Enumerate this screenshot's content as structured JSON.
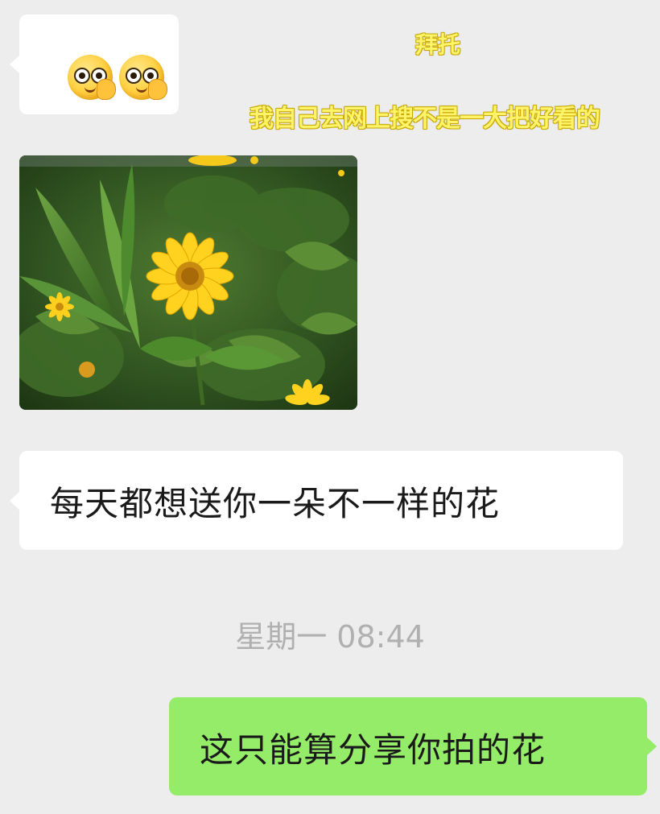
{
  "captions": {
    "line1": "拜托",
    "line2": "我自己去网上搜不是一大把好看的"
  },
  "messages": [
    {
      "sender": "other",
      "type": "sticker",
      "content": [
        "thinking-face-emoji",
        "thinking-face-emoji"
      ]
    },
    {
      "sender": "other",
      "type": "photo",
      "content": "yellow-flower-photo"
    },
    {
      "sender": "other",
      "type": "text",
      "text": "每天都想送你一朵不一样的花"
    },
    {
      "type": "timestamp",
      "text": "星期一 08:44"
    },
    {
      "sender": "me",
      "type": "text",
      "text": "这只能算分享你拍的花"
    }
  ],
  "colors": {
    "background": "#ededed",
    "incoming_bubble": "#ffffff",
    "outgoing_bubble": "#95ec69",
    "timestamp_text": "#b0b0b0",
    "caption_text": "#fff36a"
  }
}
